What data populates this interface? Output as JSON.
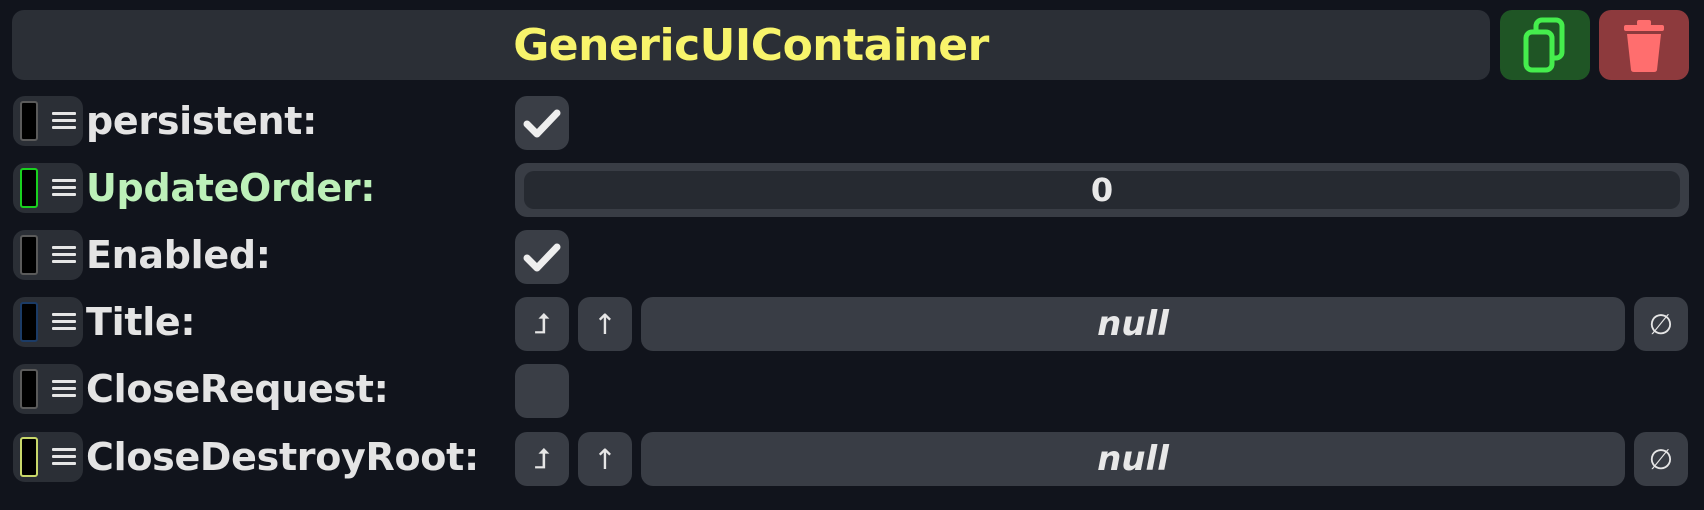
{
  "header": {
    "title": "GenericUIContainer",
    "title_color": "#f8f46b",
    "duplicate_icon": "duplicate-icon",
    "delete_icon": "trash-icon"
  },
  "fields": [
    {
      "label": "persistent:",
      "swatch_color": "#5a5a5a",
      "type": "checkbox",
      "checked": true
    },
    {
      "label": "UpdateOrder:",
      "swatch_color": "#19d11f",
      "type": "number",
      "value": "0"
    },
    {
      "label": "Enabled:",
      "swatch_color": "#5a5a5a",
      "type": "checkbox",
      "checked": true
    },
    {
      "label": "Title:",
      "swatch_color": "#1b3b66",
      "type": "reference",
      "value": "null",
      "jump_glyph": "⮥",
      "up_glyph": "↑",
      "clear_glyph": "∅"
    },
    {
      "label": "CloseRequest:",
      "swatch_color": "#5a5a5a",
      "type": "checkbox",
      "checked": false
    },
    {
      "label": "CloseDestroyRoot:",
      "swatch_color": "#c9d86a",
      "type": "reference",
      "value": "null",
      "jump_glyph": "⮥",
      "up_glyph": "↑",
      "clear_glyph": "∅"
    }
  ]
}
